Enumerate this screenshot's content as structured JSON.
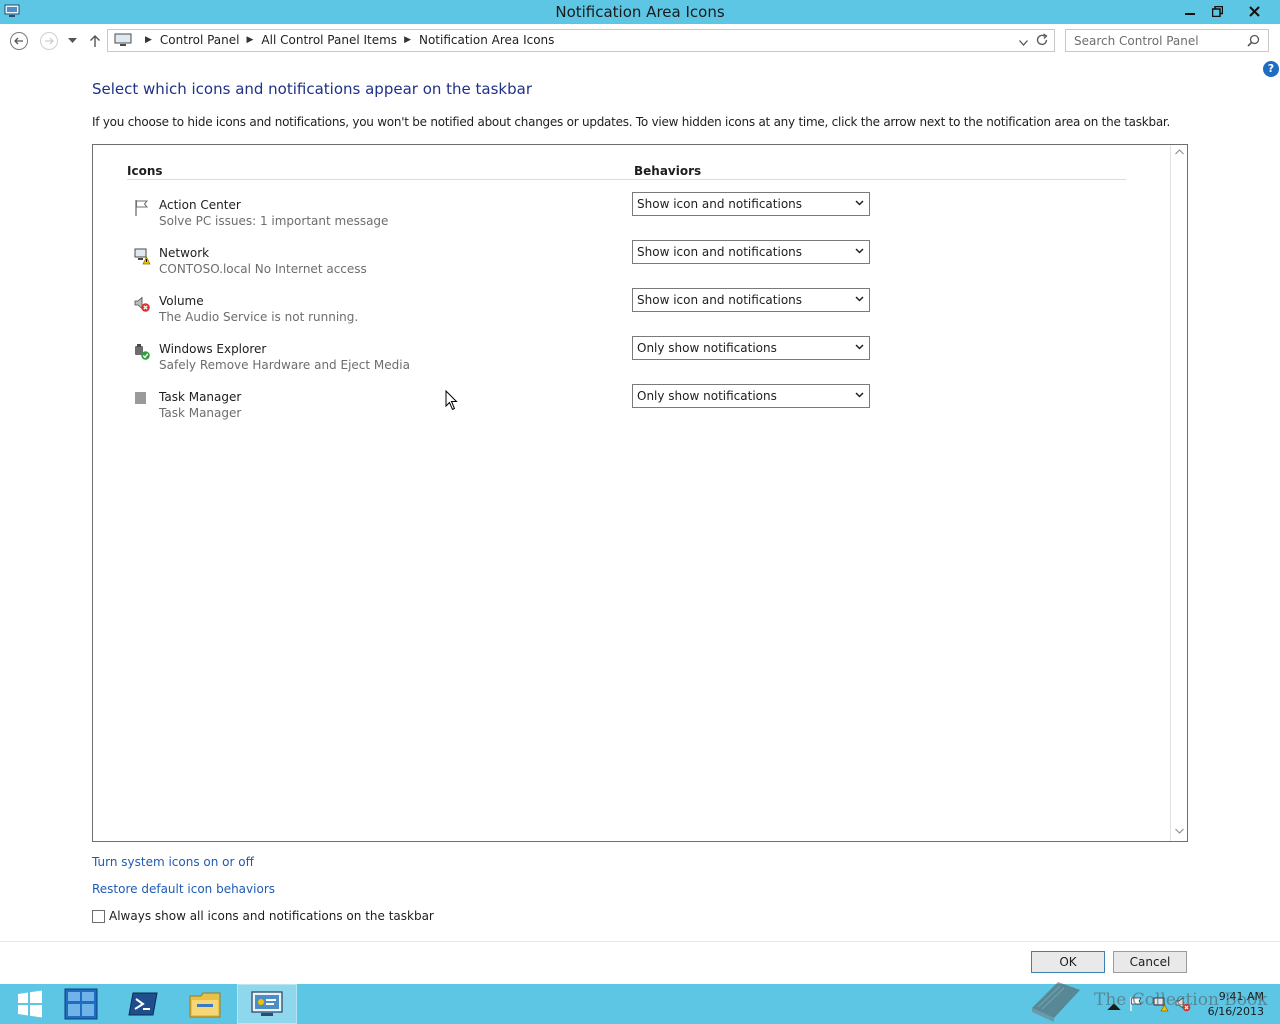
{
  "window": {
    "title": "Notification Area Icons",
    "controls": {
      "minimize_icon": "minimize-icon",
      "restore_icon": "restore-icon",
      "close_icon": "close-icon"
    }
  },
  "address": {
    "crumbs": [
      "Control Panel",
      "All Control Panel Items",
      "Notification Area Icons"
    ],
    "search_placeholder": "Search Control Panel"
  },
  "main": {
    "heading": "Select which icons and notifications appear on the taskbar",
    "description": "If you choose to hide icons and notifications, you won't be notified about changes or updates. To view hidden icons at any time, click the arrow next to the notification area on the taskbar.",
    "columns": {
      "icons": "Icons",
      "behaviors": "Behaviors"
    },
    "items": [
      {
        "name": "Action Center",
        "detail": "Solve PC issues: 1 important message",
        "behavior": "Show icon and notifications",
        "icon": "flag-icon"
      },
      {
        "name": "Network",
        "detail": "CONTOSO.local No Internet access",
        "behavior": "Show icon and notifications",
        "icon": "network-warning-icon"
      },
      {
        "name": "Volume",
        "detail": "The Audio Service is not running.",
        "behavior": "Show icon and notifications",
        "icon": "volume-error-icon"
      },
      {
        "name": "Windows Explorer",
        "detail": "Safely Remove Hardware and Eject Media",
        "behavior": "Only show notifications",
        "icon": "safely-remove-icon"
      },
      {
        "name": "Task Manager",
        "detail": "Task Manager",
        "behavior": "Only show notifications",
        "icon": "task-manager-icon"
      }
    ],
    "links": {
      "system_icons": "Turn system icons on or off",
      "restore_defaults": "Restore default icon behaviors"
    },
    "always_show_label": "Always show all icons and notifications on the taskbar",
    "always_show_checked": false
  },
  "buttons": {
    "ok": "OK",
    "cancel": "Cancel"
  },
  "taskbar": {
    "apps": [
      "start-icon",
      "server-manager-icon",
      "powershell-icon",
      "file-explorer-icon",
      "control-panel-icon"
    ],
    "time": "9:41 AM",
    "date": "6/16/2013"
  },
  "watermark": "The Collection Book",
  "colors": {
    "titlebar": "#5cc6e4",
    "heading": "#1e3287",
    "link": "#1e5bb4"
  }
}
